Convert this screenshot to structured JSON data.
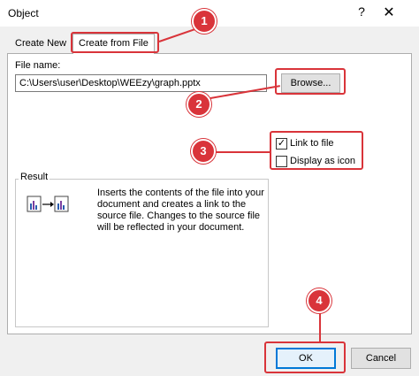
{
  "window": {
    "title": "Object",
    "help_glyph": "?",
    "close_glyph": "✕"
  },
  "tabs": {
    "create_new": "Create New",
    "create_from_file": "Create from File"
  },
  "file": {
    "label": "File name:",
    "value": "C:\\Users\\user\\Desktop\\WEEzy\\graph.pptx",
    "browse_label": "Browse..."
  },
  "options": {
    "link_to_file": {
      "label": "Link to file",
      "checked": true
    },
    "display_as_icon": {
      "label": "Display as icon",
      "checked": false
    }
  },
  "result": {
    "legend": "Result",
    "text": "Inserts the contents of the file into your document and creates a link to the source file. Changes to the source file will be reflected in your document."
  },
  "buttons": {
    "ok": "OK",
    "cancel": "Cancel"
  },
  "annotations": {
    "color": "#d9343a",
    "steps": [
      "1",
      "2",
      "3",
      "4"
    ]
  }
}
